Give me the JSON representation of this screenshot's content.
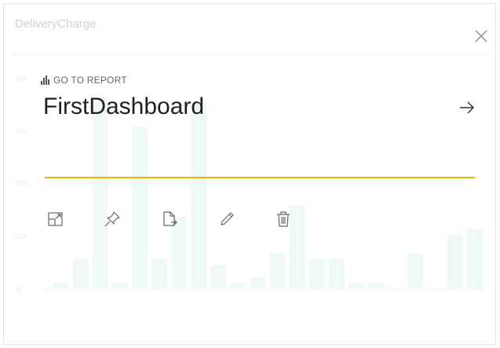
{
  "tile": {
    "title": "DeliveryCharge",
    "subtitle": "",
    "chart_data": {
      "type": "bar",
      "values": [
        1,
        5,
        32,
        1,
        27,
        5,
        12,
        31,
        4,
        1,
        2,
        6,
        14,
        5,
        5,
        1,
        1,
        0,
        6,
        0,
        9,
        10
      ],
      "ylim": [
        0,
        35
      ],
      "yticks": [
        "0K",
        "10K",
        "20K",
        "30K",
        "40K"
      ],
      "grid": false
    }
  },
  "overlay": {
    "close_icon": "close-icon",
    "goto_icon": "bar-chart-icon",
    "goto_label": "GO TO REPORT",
    "dashboard_name": "FirstDashboard",
    "arrow_icon": "arrow-right-icon",
    "accent_color": "#E8B500",
    "actions": [
      {
        "icon": "focus-mode-icon"
      },
      {
        "icon": "pin-icon"
      },
      {
        "icon": "export-data-icon"
      },
      {
        "icon": "edit-icon"
      },
      {
        "icon": "delete-icon"
      }
    ]
  }
}
